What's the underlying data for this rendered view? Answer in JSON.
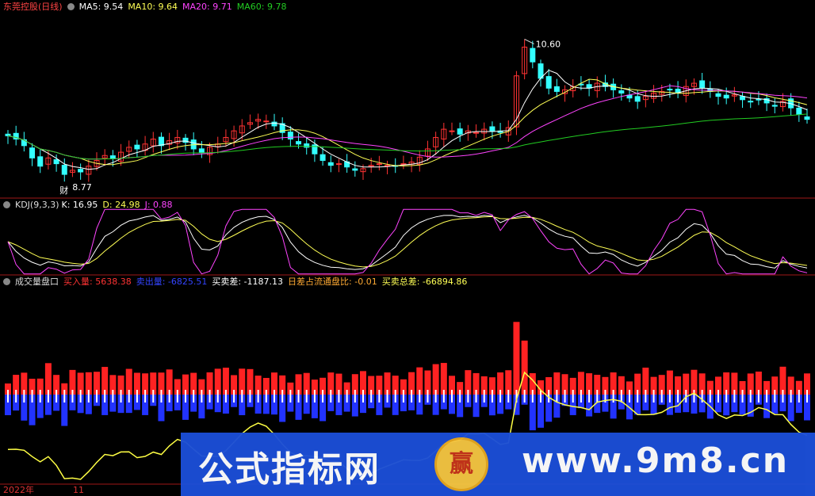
{
  "panels": {
    "price": {
      "title": "东莞控股(日线)",
      "ma5_label": "MA5: 9.54",
      "ma10_label": "MA10: 9.64",
      "ma20_label": "MA20: 9.71",
      "ma60_label": "MA60: 9.78",
      "high_label": "10.60",
      "low_label": "8.77",
      "low_tag": "财",
      "colors": {
        "ma5": "#ffffff",
        "ma10": "#ffff55",
        "ma20": "#ff44ff",
        "ma60": "#22cc22",
        "up": "#ff3333",
        "down": "#33ffff"
      }
    },
    "kdj": {
      "title": "KDJ(9,3,3)",
      "k_label": "K: 16.95",
      "d_label": "D: 24.98",
      "j_label": "J: 0.88",
      "colors": {
        "k": "#ffffff",
        "d": "#ffff55",
        "j": "#ff44ff"
      }
    },
    "volume": {
      "title": "成交量盘口",
      "buy_label": "买入量: 5638.38",
      "sell_label": "卖出量: -6825.51",
      "diff_label": "买卖差: -1187.13",
      "ratio_label": "日差占流通盘比: -0.01",
      "total_label": "买卖总差: -66894.86",
      "colors": {
        "buy": "#ff2222",
        "sell": "#2233ff",
        "line": "#ffff44"
      }
    }
  },
  "x_axis": {
    "year_label": "2022年",
    "month_label": "11"
  },
  "watermark": {
    "text_left": "公式指标网",
    "text_right": "www.9m8.cn",
    "logo": "赢"
  },
  "chart_data": [
    {
      "type": "candlestick",
      "title": "东莞控股(日线)",
      "annotations": [
        {
          "text": "10.60",
          "kind": "max"
        },
        {
          "text": "8.77",
          "kind": "min"
        }
      ],
      "series": [
        {
          "name": "MA5",
          "last": 9.54
        },
        {
          "name": "MA10",
          "last": 9.64
        },
        {
          "name": "MA20",
          "last": 9.71
        },
        {
          "name": "MA60",
          "last": 9.78
        }
      ],
      "close": [
        9.32,
        9.28,
        9.2,
        9.05,
        8.95,
        9.05,
        8.98,
        8.85,
        8.9,
        8.88,
        8.95,
        9.02,
        9.08,
        9.04,
        9.12,
        9.18,
        9.16,
        9.22,
        9.28,
        9.2,
        9.26,
        9.3,
        9.24,
        9.16,
        9.12,
        9.18,
        9.22,
        9.3,
        9.38,
        9.44,
        9.48,
        9.52,
        9.5,
        9.44,
        9.36,
        9.28,
        9.22,
        9.18,
        9.1,
        9.02,
        8.96,
        8.98,
        8.94,
        8.9,
        8.92,
        8.96,
        8.98,
        8.96,
        8.95,
        8.98,
        9.0,
        9.06,
        9.16,
        9.3,
        9.4,
        9.38,
        9.34,
        9.38,
        9.36,
        9.4,
        9.38,
        9.36,
        9.42,
        10.05,
        10.4,
        10.22,
        10.02,
        9.9,
        9.86,
        9.88,
        9.92,
        9.94,
        9.9,
        9.96,
        9.92,
        9.88,
        9.84,
        9.78,
        9.74,
        9.8,
        9.84,
        9.86,
        9.88,
        9.84,
        9.92,
        9.96,
        9.9,
        9.86,
        9.8,
        9.78,
        9.82,
        9.76,
        9.74,
        9.76,
        9.72,
        9.68,
        9.74,
        9.66,
        9.58,
        9.52
      ],
      "ylim": [
        8.6,
        10.8
      ]
    },
    {
      "type": "line",
      "title": "KDJ(9,3,3)",
      "series": [
        {
          "name": "K",
          "last": 16.95
        },
        {
          "name": "D",
          "last": 24.98
        },
        {
          "name": "J",
          "last": 0.88
        }
      ]
    },
    {
      "type": "bar",
      "title": "成交量盘口",
      "series": [
        {
          "name": "买入量",
          "last": 5638.38
        },
        {
          "name": "卖出量",
          "last": -6825.51
        },
        {
          "name": "买卖差",
          "last": -1187.13
        },
        {
          "name": "日差占流通盘比",
          "last": -0.01
        },
        {
          "name": "买卖总差",
          "last": -66894.86
        }
      ]
    }
  ]
}
